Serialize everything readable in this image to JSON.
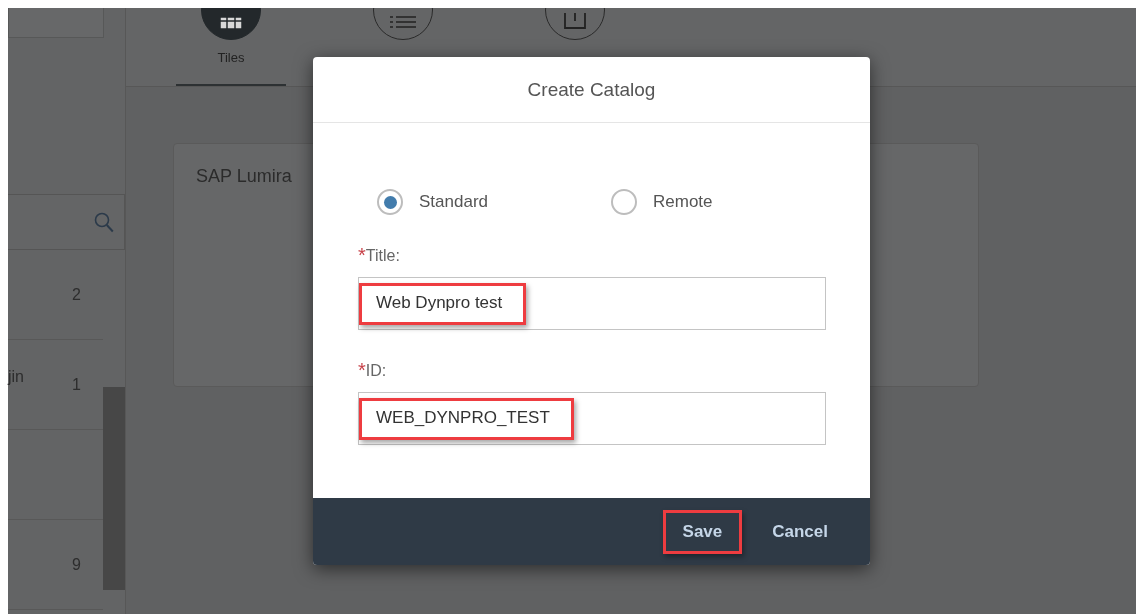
{
  "sidebar": {
    "rows": [
      {
        "count": "2"
      },
      {
        "label": "jin",
        "count": "1"
      },
      {},
      {
        "count": "9"
      }
    ]
  },
  "tabs": [
    {
      "label": "Tiles",
      "kind": "grid",
      "selected": true
    },
    {
      "kind": "list",
      "selected": false
    },
    {
      "kind": "box",
      "selected": false
    }
  ],
  "tile": {
    "title": "SAP Lumira"
  },
  "dialog": {
    "title": "Create Catalog",
    "options": [
      {
        "label": "Standard",
        "selected": true
      },
      {
        "label": "Remote",
        "selected": false
      }
    ],
    "fields": [
      {
        "required_mark": "*",
        "label": "Title:",
        "value": "Web Dynpro test",
        "highlighted": true
      },
      {
        "required_mark": "*",
        "label": "ID:",
        "value": "WEB_DYNPRO_TEST",
        "highlighted": true
      }
    ],
    "buttons": [
      {
        "label": "Save",
        "highlighted": true
      },
      {
        "label": "Cancel",
        "highlighted": false
      }
    ]
  }
}
